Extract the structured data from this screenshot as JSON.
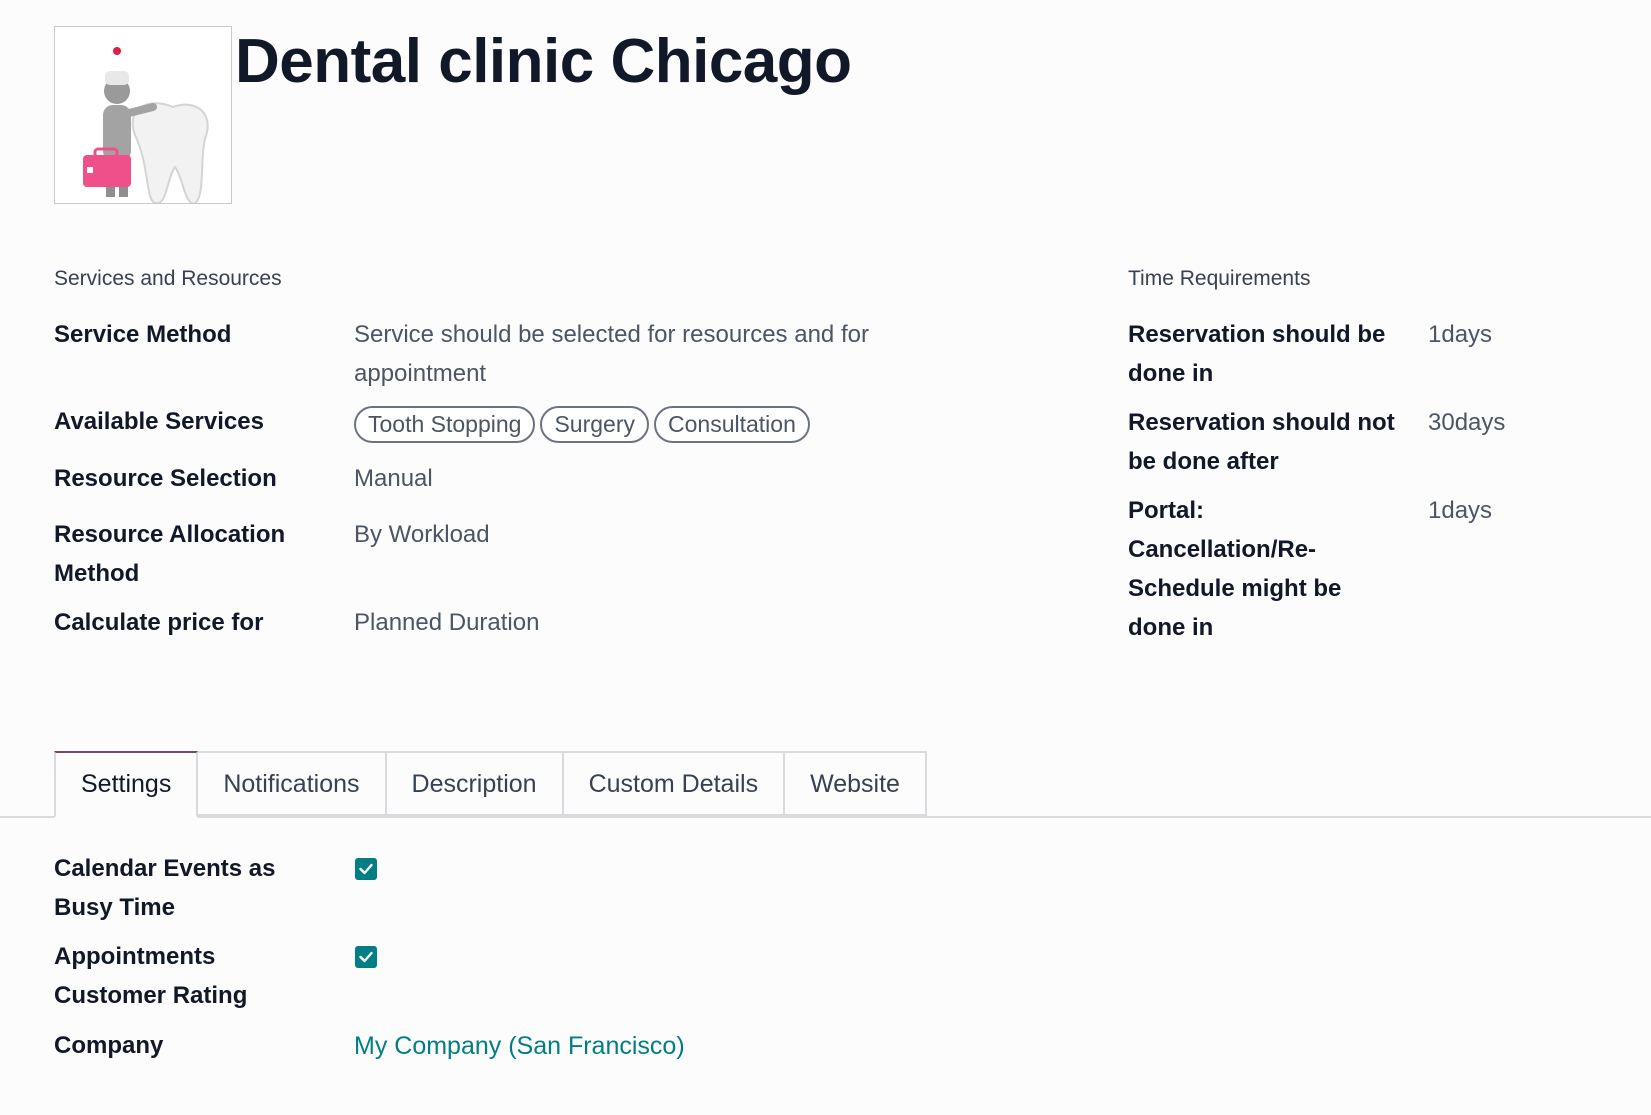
{
  "record": {
    "title": "Dental clinic Chicago",
    "image_icon": "dentist-with-tooth-icon"
  },
  "services_section": {
    "title": "Services and Resources",
    "service_method": {
      "label": "Service Method",
      "value_line1": "Service should be selected for resources and for",
      "value_line2": "appointment"
    },
    "available_services": {
      "label": "Available Services",
      "tags": [
        "Tooth Stopping",
        "Surgery",
        "Consultation"
      ]
    },
    "resource_selection": {
      "label": "Resource Selection",
      "value": "Manual"
    },
    "resource_allocation": {
      "label_line1": "Resource Allocation",
      "label_line2": "Method",
      "value": "By Workload"
    },
    "calculate_price": {
      "label": "Calculate price for",
      "value": "Planned Duration"
    }
  },
  "time_section": {
    "title": "Time Requirements",
    "reservation_in": {
      "label_line1": "Reservation should be",
      "label_line2": "done in",
      "value": "1days"
    },
    "reservation_not_after": {
      "label_line1": "Reservation should not",
      "label_line2": "be done after",
      "value": "30days"
    },
    "portal_cancel": {
      "label_line1": "Portal:",
      "label_line2": "Cancellation/Re-",
      "label_line3": "Schedule might be",
      "label_line4": "done in",
      "value": "1days"
    }
  },
  "tabs": [
    "Settings",
    "Notifications",
    "Description",
    "Custom Details",
    "Website"
  ],
  "active_tab": "Settings",
  "settings": {
    "calendar_busy": {
      "label_line1": "Calendar Events as",
      "label_line2": "Busy Time",
      "checked": true
    },
    "customer_rating": {
      "label_line1": "Appointments",
      "label_line2": "Customer Rating",
      "checked": true
    },
    "company": {
      "label": "Company",
      "value": "My Company (San Francisco)"
    }
  },
  "colors": {
    "accent": "#017e84",
    "tab_active_border": "#714b67"
  }
}
